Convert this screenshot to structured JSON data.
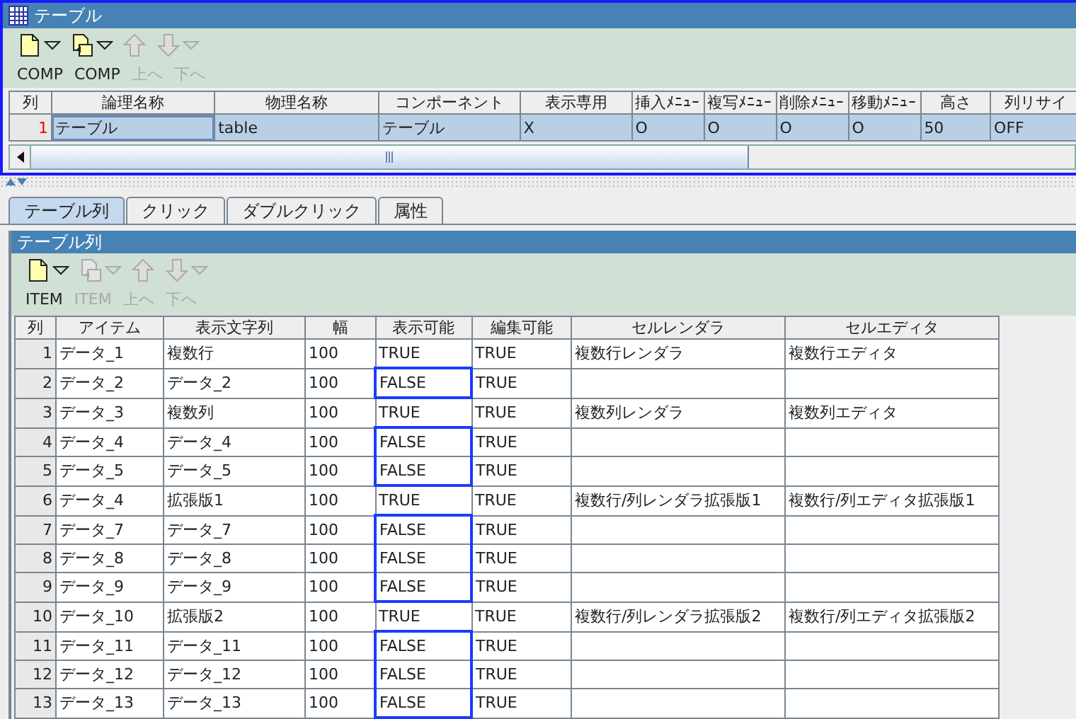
{
  "window": {
    "title": "テーブル"
  },
  "toolbar": [
    {
      "kind": "new",
      "label": "COMP",
      "dropdown": true,
      "disabled": false
    },
    {
      "kind": "copy",
      "label": "COMP",
      "dropdown": true,
      "disabled": false
    },
    {
      "kind": "up",
      "label": "上へ",
      "dropdown": false,
      "disabled": true
    },
    {
      "kind": "down",
      "label": "下へ",
      "dropdown": true,
      "disabled": true
    }
  ],
  "table": {
    "columns": [
      {
        "label": "列"
      },
      {
        "label": "論理名称"
      },
      {
        "label": "物理名称"
      },
      {
        "label": "コンポーネント"
      },
      {
        "label": "表示専用"
      },
      {
        "label": "挿入ﾒﾆｭｰ"
      },
      {
        "label": "複写ﾒﾆｭｰ"
      },
      {
        "label": "削除ﾒﾆｭｰ"
      },
      {
        "label": "移動ﾒﾆｭｰ"
      },
      {
        "label": "高さ"
      },
      {
        "label": "列リサイ"
      }
    ],
    "rows": [
      {
        "selected": true,
        "cells": [
          "1",
          "テーブル",
          "table",
          "テーブル",
          "X",
          "O",
          "O",
          "O",
          "O",
          "50",
          "OFF"
        ]
      }
    ]
  },
  "tabs": [
    {
      "label": "テーブル列",
      "selected": true
    },
    {
      "label": "クリック",
      "selected": false
    },
    {
      "label": "ダブルクリック",
      "selected": false
    },
    {
      "label": "属性",
      "selected": false
    }
  ],
  "panel": {
    "title": "テーブル列",
    "toolbar": [
      {
        "kind": "new",
        "label": "ITEM",
        "dropdown": true,
        "disabled": false
      },
      {
        "kind": "copy",
        "label": "ITEM",
        "dropdown": true,
        "disabled": true
      },
      {
        "kind": "up",
        "label": "上へ",
        "dropdown": false,
        "disabled": true
      },
      {
        "kind": "down",
        "label": "下へ",
        "dropdown": true,
        "disabled": true
      }
    ],
    "table": {
      "columns": [
        {
          "label": "列",
          "outlined": false
        },
        {
          "label": "アイテム",
          "outlined": false
        },
        {
          "label": "表示文字列",
          "outlined": false
        },
        {
          "label": "幅",
          "outlined": false
        },
        {
          "label": "表示可能",
          "outlined": true
        },
        {
          "label": "編集可能",
          "outlined": false
        },
        {
          "label": "セルレンダラ",
          "outlined": false
        },
        {
          "label": "セルエディタ",
          "outlined": false
        }
      ],
      "rows": [
        {
          "outlined": false,
          "cells": [
            "1",
            "データ_1",
            "複数行",
            "100",
            "TRUE",
            "TRUE",
            "複数行レンダラ",
            "複数行エディタ"
          ]
        },
        {
          "outlined": true,
          "cells": [
            "2",
            "データ_2",
            "データ_2",
            "100",
            "FALSE",
            "TRUE",
            "",
            ""
          ]
        },
        {
          "outlined": false,
          "cells": [
            "3",
            "データ_3",
            "複数列",
            "100",
            "TRUE",
            "TRUE",
            "複数列レンダラ",
            "複数列エディタ"
          ]
        },
        {
          "outlined": true,
          "cells": [
            "4",
            "データ_4",
            "データ_4",
            "100",
            "FALSE",
            "TRUE",
            "",
            ""
          ]
        },
        {
          "outlined": true,
          "cells": [
            "5",
            "データ_5",
            "データ_5",
            "100",
            "FALSE",
            "TRUE",
            "",
            ""
          ]
        },
        {
          "outlined": false,
          "cells": [
            "6",
            "データ_4",
            "拡張版1",
            "100",
            "TRUE",
            "TRUE",
            "複数行/列レンダラ拡張版1",
            "複数行/列エディタ拡張版1"
          ]
        },
        {
          "outlined": true,
          "cells": [
            "7",
            "データ_7",
            "データ_7",
            "100",
            "FALSE",
            "TRUE",
            "",
            ""
          ]
        },
        {
          "outlined": true,
          "cells": [
            "8",
            "データ_8",
            "データ_8",
            "100",
            "FALSE",
            "TRUE",
            "",
            ""
          ]
        },
        {
          "outlined": true,
          "cells": [
            "9",
            "データ_9",
            "データ_9",
            "100",
            "FALSE",
            "TRUE",
            "",
            ""
          ]
        },
        {
          "outlined": false,
          "cells": [
            "10",
            "データ_10",
            "拡張版2",
            "100",
            "TRUE",
            "TRUE",
            "複数行/列レンダラ拡張版2",
            "複数行/列エディタ拡張版2"
          ]
        },
        {
          "outlined": true,
          "cells": [
            "11",
            "データ_11",
            "データ_11",
            "100",
            "FALSE",
            "TRUE",
            "",
            ""
          ]
        },
        {
          "outlined": true,
          "cells": [
            "12",
            "データ_12",
            "データ_12",
            "100",
            "FALSE",
            "TRUE",
            "",
            ""
          ]
        },
        {
          "outlined": true,
          "cells": [
            "13",
            "データ_13",
            "データ_13",
            "100",
            "FALSE",
            "TRUE",
            "",
            ""
          ]
        }
      ]
    }
  }
}
